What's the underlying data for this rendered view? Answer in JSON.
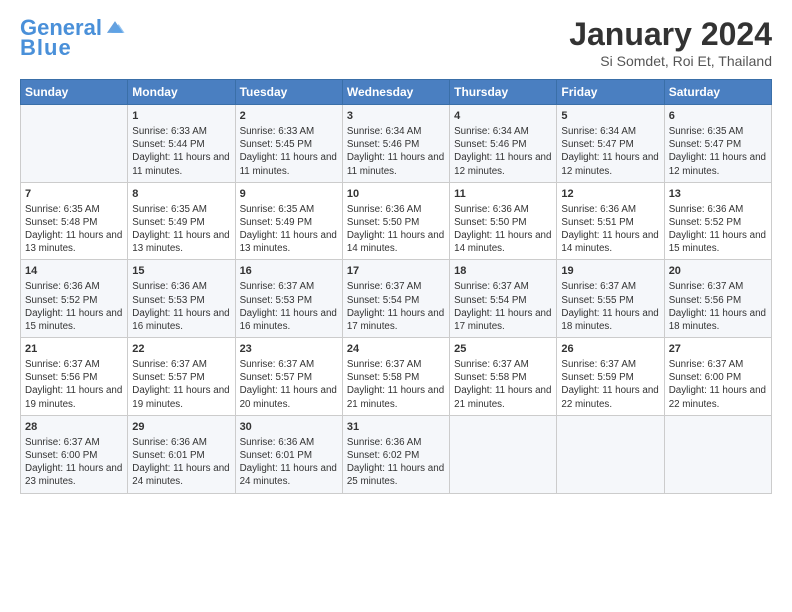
{
  "header": {
    "logo_line1": "General",
    "logo_line2": "Blue",
    "title": "January 2024",
    "subtitle": "Si Somdet, Roi Et, Thailand"
  },
  "columns": [
    "Sunday",
    "Monday",
    "Tuesday",
    "Wednesday",
    "Thursday",
    "Friday",
    "Saturday"
  ],
  "weeks": [
    [
      {
        "day": "",
        "sunrise": "",
        "sunset": "",
        "daylight": ""
      },
      {
        "day": "1",
        "sunrise": "Sunrise: 6:33 AM",
        "sunset": "Sunset: 5:44 PM",
        "daylight": "Daylight: 11 hours and 11 minutes."
      },
      {
        "day": "2",
        "sunrise": "Sunrise: 6:33 AM",
        "sunset": "Sunset: 5:45 PM",
        "daylight": "Daylight: 11 hours and 11 minutes."
      },
      {
        "day": "3",
        "sunrise": "Sunrise: 6:34 AM",
        "sunset": "Sunset: 5:46 PM",
        "daylight": "Daylight: 11 hours and 11 minutes."
      },
      {
        "day": "4",
        "sunrise": "Sunrise: 6:34 AM",
        "sunset": "Sunset: 5:46 PM",
        "daylight": "Daylight: 11 hours and 12 minutes."
      },
      {
        "day": "5",
        "sunrise": "Sunrise: 6:34 AM",
        "sunset": "Sunset: 5:47 PM",
        "daylight": "Daylight: 11 hours and 12 minutes."
      },
      {
        "day": "6",
        "sunrise": "Sunrise: 6:35 AM",
        "sunset": "Sunset: 5:47 PM",
        "daylight": "Daylight: 11 hours and 12 minutes."
      }
    ],
    [
      {
        "day": "7",
        "sunrise": "Sunrise: 6:35 AM",
        "sunset": "Sunset: 5:48 PM",
        "daylight": "Daylight: 11 hours and 13 minutes."
      },
      {
        "day": "8",
        "sunrise": "Sunrise: 6:35 AM",
        "sunset": "Sunset: 5:49 PM",
        "daylight": "Daylight: 11 hours and 13 minutes."
      },
      {
        "day": "9",
        "sunrise": "Sunrise: 6:35 AM",
        "sunset": "Sunset: 5:49 PM",
        "daylight": "Daylight: 11 hours and 13 minutes."
      },
      {
        "day": "10",
        "sunrise": "Sunrise: 6:36 AM",
        "sunset": "Sunset: 5:50 PM",
        "daylight": "Daylight: 11 hours and 14 minutes."
      },
      {
        "day": "11",
        "sunrise": "Sunrise: 6:36 AM",
        "sunset": "Sunset: 5:50 PM",
        "daylight": "Daylight: 11 hours and 14 minutes."
      },
      {
        "day": "12",
        "sunrise": "Sunrise: 6:36 AM",
        "sunset": "Sunset: 5:51 PM",
        "daylight": "Daylight: 11 hours and 14 minutes."
      },
      {
        "day": "13",
        "sunrise": "Sunrise: 6:36 AM",
        "sunset": "Sunset: 5:52 PM",
        "daylight": "Daylight: 11 hours and 15 minutes."
      }
    ],
    [
      {
        "day": "14",
        "sunrise": "Sunrise: 6:36 AM",
        "sunset": "Sunset: 5:52 PM",
        "daylight": "Daylight: 11 hours and 15 minutes."
      },
      {
        "day": "15",
        "sunrise": "Sunrise: 6:36 AM",
        "sunset": "Sunset: 5:53 PM",
        "daylight": "Daylight: 11 hours and 16 minutes."
      },
      {
        "day": "16",
        "sunrise": "Sunrise: 6:37 AM",
        "sunset": "Sunset: 5:53 PM",
        "daylight": "Daylight: 11 hours and 16 minutes."
      },
      {
        "day": "17",
        "sunrise": "Sunrise: 6:37 AM",
        "sunset": "Sunset: 5:54 PM",
        "daylight": "Daylight: 11 hours and 17 minutes."
      },
      {
        "day": "18",
        "sunrise": "Sunrise: 6:37 AM",
        "sunset": "Sunset: 5:54 PM",
        "daylight": "Daylight: 11 hours and 17 minutes."
      },
      {
        "day": "19",
        "sunrise": "Sunrise: 6:37 AM",
        "sunset": "Sunset: 5:55 PM",
        "daylight": "Daylight: 11 hours and 18 minutes."
      },
      {
        "day": "20",
        "sunrise": "Sunrise: 6:37 AM",
        "sunset": "Sunset: 5:56 PM",
        "daylight": "Daylight: 11 hours and 18 minutes."
      }
    ],
    [
      {
        "day": "21",
        "sunrise": "Sunrise: 6:37 AM",
        "sunset": "Sunset: 5:56 PM",
        "daylight": "Daylight: 11 hours and 19 minutes."
      },
      {
        "day": "22",
        "sunrise": "Sunrise: 6:37 AM",
        "sunset": "Sunset: 5:57 PM",
        "daylight": "Daylight: 11 hours and 19 minutes."
      },
      {
        "day": "23",
        "sunrise": "Sunrise: 6:37 AM",
        "sunset": "Sunset: 5:57 PM",
        "daylight": "Daylight: 11 hours and 20 minutes."
      },
      {
        "day": "24",
        "sunrise": "Sunrise: 6:37 AM",
        "sunset": "Sunset: 5:58 PM",
        "daylight": "Daylight: 11 hours and 21 minutes."
      },
      {
        "day": "25",
        "sunrise": "Sunrise: 6:37 AM",
        "sunset": "Sunset: 5:58 PM",
        "daylight": "Daylight: 11 hours and 21 minutes."
      },
      {
        "day": "26",
        "sunrise": "Sunrise: 6:37 AM",
        "sunset": "Sunset: 5:59 PM",
        "daylight": "Daylight: 11 hours and 22 minutes."
      },
      {
        "day": "27",
        "sunrise": "Sunrise: 6:37 AM",
        "sunset": "Sunset: 6:00 PM",
        "daylight": "Daylight: 11 hours and 22 minutes."
      }
    ],
    [
      {
        "day": "28",
        "sunrise": "Sunrise: 6:37 AM",
        "sunset": "Sunset: 6:00 PM",
        "daylight": "Daylight: 11 hours and 23 minutes."
      },
      {
        "day": "29",
        "sunrise": "Sunrise: 6:36 AM",
        "sunset": "Sunset: 6:01 PM",
        "daylight": "Daylight: 11 hours and 24 minutes."
      },
      {
        "day": "30",
        "sunrise": "Sunrise: 6:36 AM",
        "sunset": "Sunset: 6:01 PM",
        "daylight": "Daylight: 11 hours and 24 minutes."
      },
      {
        "day": "31",
        "sunrise": "Sunrise: 6:36 AM",
        "sunset": "Sunset: 6:02 PM",
        "daylight": "Daylight: 11 hours and 25 minutes."
      },
      {
        "day": "",
        "sunrise": "",
        "sunset": "",
        "daylight": ""
      },
      {
        "day": "",
        "sunrise": "",
        "sunset": "",
        "daylight": ""
      },
      {
        "day": "",
        "sunrise": "",
        "sunset": "",
        "daylight": ""
      }
    ]
  ]
}
